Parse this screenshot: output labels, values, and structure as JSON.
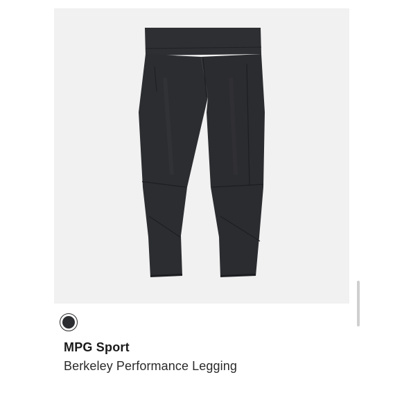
{
  "product": {
    "brand": "MPG Sport",
    "name": "Berkeley Performance Legging",
    "selected_color_hex": "#2b2d30",
    "image_background": "#f1f1f1",
    "garment_color": "#2c2d30"
  },
  "icons": {
    "more": "more-horizontal-icon",
    "swatch": "color-swatch"
  }
}
